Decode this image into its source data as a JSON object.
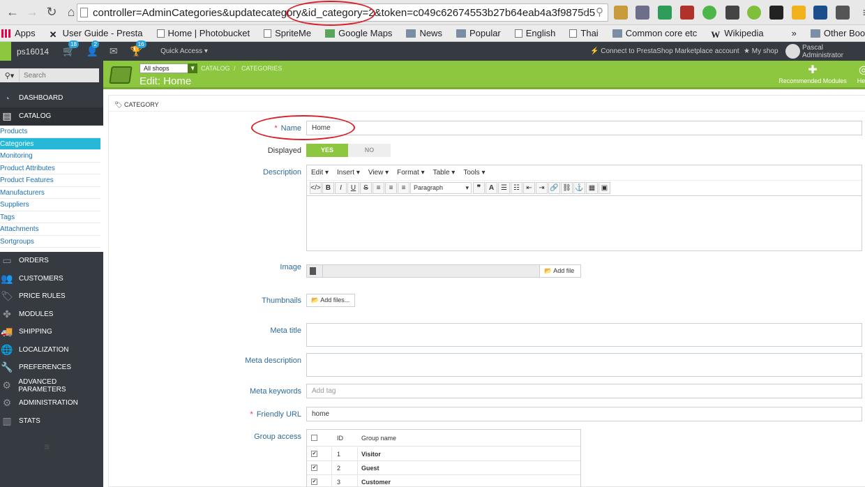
{
  "browser": {
    "url": "controller=AdminCategories&updatecategory&id_category=2&token=c049c62674553b27b64eab4a3f9875d5",
    "bookmarks": [
      "Apps",
      "User Guide - Presta",
      "Home | Photobucket",
      "SpriteMe",
      "Google Maps",
      "News",
      "Popular",
      "English",
      "Thai",
      "Common core etc",
      "Wikipedia"
    ],
    "bookmarks_more": "»",
    "other_bookmarks": "Other Bookmarks"
  },
  "topbar": {
    "shop_name": "ps16014",
    "orders_badge": "18",
    "customers_badge": "2",
    "messages_badge": "16",
    "quick_access": "Quick Access ▾",
    "marketplace": "Connect to PrestaShop Marketplace account",
    "my_shop": "My shop",
    "user": "Pascal Administrator"
  },
  "sidebar": {
    "search_placeholder": "Search",
    "menu": [
      "DASHBOARD",
      "CATALOG",
      "ORDERS",
      "CUSTOMERS",
      "PRICE RULES",
      "MODULES",
      "SHIPPING",
      "LOCALIZATION",
      "PREFERENCES",
      "ADVANCED PARAMETERS",
      "ADMINISTRATION",
      "STATS"
    ],
    "catalog_sub": [
      "Products",
      "Categories",
      "Monitoring",
      "Product Attributes",
      "Product Features",
      "Manufacturers",
      "Suppliers",
      "Tags",
      "Attachments",
      "Sortgroups"
    ]
  },
  "header": {
    "shop_select": "All shops",
    "breadcrumb": [
      "CATALOG",
      "CATEGORIES"
    ],
    "title": "Edit: Home",
    "recommended": "Recommended Modules",
    "help": "Help"
  },
  "form": {
    "panel_title": "CATEGORY",
    "name_label": "Name",
    "name_value": "Home",
    "displayed_label": "Displayed",
    "yes": "YES",
    "no": "NO",
    "description_label": "Description",
    "editor_menu": [
      "Edit ▾",
      "Insert ▾",
      "View ▾",
      "Format ▾",
      "Table ▾",
      "Tools ▾"
    ],
    "paragraph": "Paragraph",
    "image_label": "Image",
    "add_file": "Add file",
    "thumbnails_label": "Thumbnails",
    "add_files": "Add files...",
    "meta_title_label": "Meta title",
    "meta_description_label": "Meta description",
    "meta_keywords_label": "Meta keywords",
    "meta_keywords_placeholder": "Add tag",
    "friendly_url_label": "Friendly URL",
    "friendly_url_value": "home",
    "group_access_label": "Group access",
    "group_headers": [
      "ID",
      "Group name"
    ],
    "groups": [
      {
        "id": "1",
        "name": "Visitor"
      },
      {
        "id": "2",
        "name": "Guest"
      },
      {
        "id": "3",
        "name": "Customer"
      }
    ]
  },
  "colors": {
    "accent_green": "#8dc63f",
    "sidebar_bg": "#363a41",
    "active_blue": "#25b9d7",
    "annotation_red": "#d9202a"
  }
}
